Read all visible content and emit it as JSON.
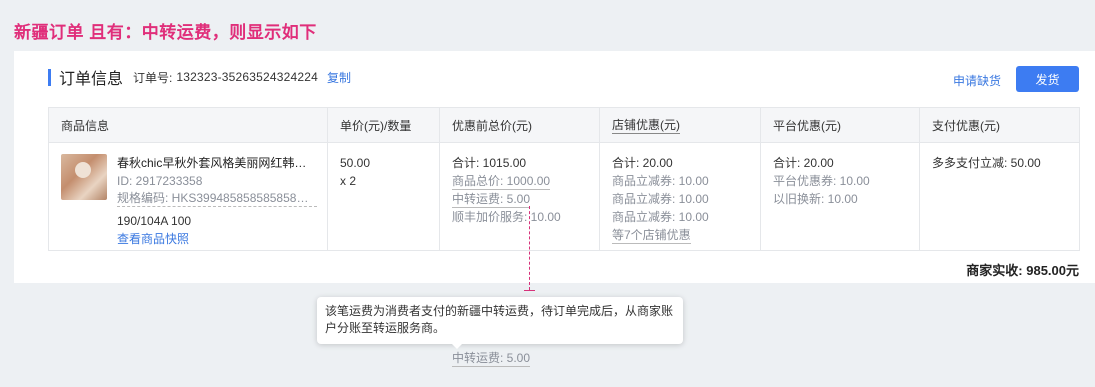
{
  "banner": "新疆订单 且有：中转运费，则显示如下",
  "header": {
    "title": "订单信息",
    "order_label": "订单号:",
    "order_no": "132323-35263524324224",
    "copy": "复制",
    "apply": "申请缺货",
    "ship": "发货"
  },
  "table": {
    "columns": [
      "商品信息",
      "单价(元)/数量",
      "优惠前总价(元)",
      "店铺优惠(元)",
      "平台优惠(元)",
      "支付优惠(元)"
    ],
    "product": {
      "name": "春秋chic早秋外套风格美丽网红韩…",
      "id": "ID: 2917233358",
      "sku": "规格编码: HKS399485858585858…",
      "spec": "190/104A 100",
      "snapshot": "查看商品快照"
    },
    "price": {
      "unit": "50.00",
      "qty": "x 2"
    },
    "pre_total": {
      "sum": "合计: 1015.00",
      "goods_total": "商品总价: 1000.00",
      "transfer_fee": "中转运费: 5.00",
      "sf_service": "顺丰加价服务: 10.00"
    },
    "store_discount": {
      "sum": "合计: 20.00",
      "items": [
        "商品立减券: 10.00",
        "商品立减券: 10.00",
        "商品立减券: 10.00"
      ],
      "more": "等7个店铺优惠"
    },
    "platform_discount": {
      "sum": "合计: 20.00",
      "items": [
        "平台优惠券: 10.00",
        "以旧换新: 10.00"
      ]
    },
    "pay_discount": {
      "text": "多多支付立减: 50.00"
    }
  },
  "settlement": "商家实收: 985.00元",
  "tooltip": {
    "text": "该笔运费为消费者支付的新疆中转运费，待订单完成后，从商家账户分账至转运服务商。",
    "anchor_label": "中转运费: 5.00"
  },
  "colors": {
    "accent": "#3d7cf2",
    "banner": "#e02e7a",
    "guide": "#d6337a",
    "link": "#3a78e0"
  }
}
